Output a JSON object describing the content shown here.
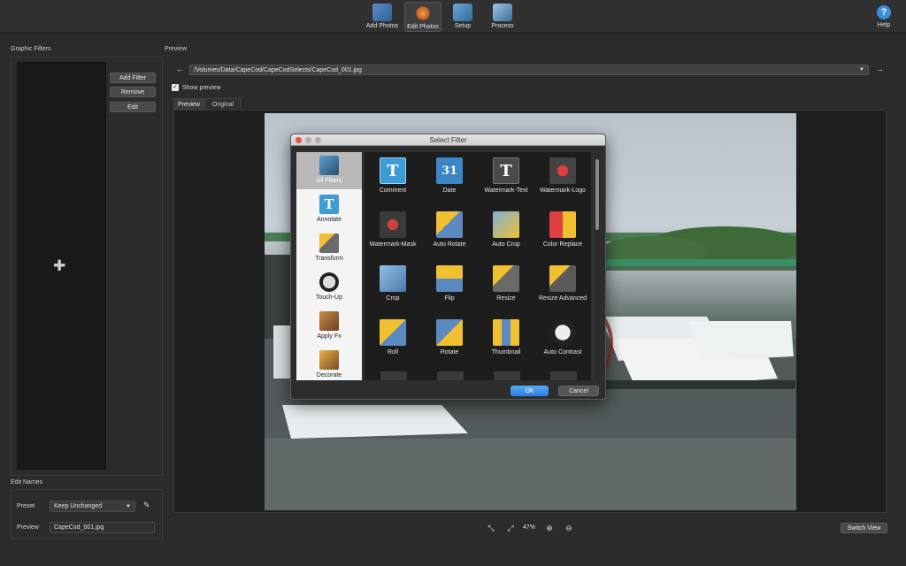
{
  "toolbar": {
    "add_photos": "Add Photos",
    "edit_photos": "Edit Photos",
    "setup": "Setup",
    "process": "Process",
    "help": "Help",
    "help_glyph": "?"
  },
  "graphic_filters": {
    "title": "Graphic Filters",
    "add_filter": "Add Filter",
    "remove": "Remove",
    "edit": "Edit",
    "add_glyph": "✚"
  },
  "edit_names": {
    "title": "Edit Names",
    "preset_label": "Preset",
    "preset_value": "Keep Unchanged",
    "preview_label": "Preview",
    "preview_value": "CapeCod_001.jpg"
  },
  "preview": {
    "title": "Preview",
    "path": "/Volumes/Data/CapeCod/CapeCodSelects/CapeCod_001.jpg",
    "show_preview": "Show preview",
    "show_preview_checked": true,
    "tabs": [
      "Preview",
      "Original"
    ],
    "active_tab": "Preview",
    "prev_arrow": "←",
    "next_arrow": "→",
    "zoom": "47%",
    "switch_view": "Switch View"
  },
  "dialog": {
    "title": "Select Filter",
    "categories": [
      {
        "label": "All Filters",
        "icon": "all-filters-icon",
        "selected": true
      },
      {
        "label": "Annotate",
        "icon": "annotate-icon"
      },
      {
        "label": "Transform",
        "icon": "transform-icon"
      },
      {
        "label": "Touch-Up",
        "icon": "touch-up-icon"
      },
      {
        "label": "Apply Fx",
        "icon": "apply-fx-icon"
      },
      {
        "label": "Decorate",
        "icon": "decorate-icon"
      }
    ],
    "filters": [
      {
        "label": "Comment",
        "icon": "comment-icon",
        "glyph": "T"
      },
      {
        "label": "Date",
        "icon": "date-icon",
        "glyph": "31"
      },
      {
        "label": "Watermark-Text",
        "icon": "watermark-text-icon",
        "glyph": "T"
      },
      {
        "label": "Watermark-Logo",
        "icon": "watermark-logo-icon",
        "glyph": ""
      },
      {
        "label": "Watermark-Mask",
        "icon": "watermark-mask-icon",
        "glyph": ""
      },
      {
        "label": "Auto Rotate",
        "icon": "auto-rotate-icon",
        "glyph": ""
      },
      {
        "label": "Auto Crop",
        "icon": "auto-crop-icon",
        "glyph": ""
      },
      {
        "label": "Color Replace",
        "icon": "color-replace-icon",
        "glyph": ""
      },
      {
        "label": "Crop",
        "icon": "crop-icon",
        "glyph": ""
      },
      {
        "label": "Flip",
        "icon": "flip-icon",
        "glyph": ""
      },
      {
        "label": "Resize",
        "icon": "resize-icon",
        "glyph": ""
      },
      {
        "label": "Resize Advanced",
        "icon": "resize-advanced-icon",
        "glyph": ""
      },
      {
        "label": "Roll",
        "icon": "roll-icon",
        "glyph": ""
      },
      {
        "label": "Rotate",
        "icon": "rotate-icon",
        "glyph": ""
      },
      {
        "label": "Thumbnail",
        "icon": "thumbnail-icon",
        "glyph": ""
      },
      {
        "label": "Auto Contrast",
        "icon": "auto-contrast-icon",
        "glyph": ""
      }
    ],
    "ok": "OK",
    "cancel": "Cancel"
  }
}
